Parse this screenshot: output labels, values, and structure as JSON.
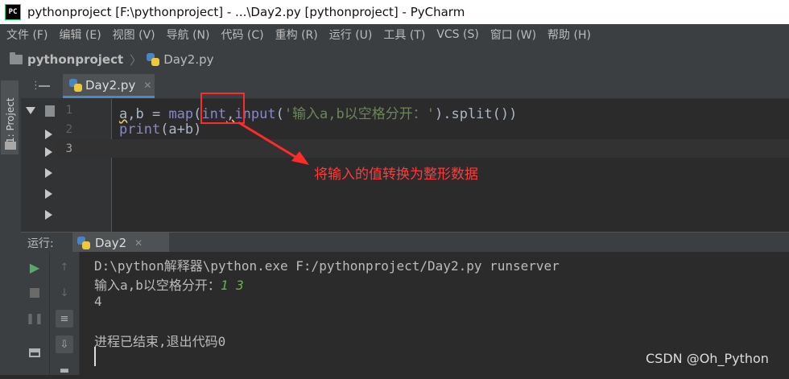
{
  "window": {
    "title": "pythonproject [F:\\pythonproject] - ...\\Day2.py [pythonproject] - PyCharm",
    "icon_text": "PC"
  },
  "menu": [
    "文件 (F)",
    "编辑 (E)",
    "视图 (V)",
    "导航 (N)",
    "代码 (C)",
    "重构 (R)",
    "运行 (U)",
    "工具 (T)",
    "VCS (S)",
    "窗口 (W)",
    "帮助 (H)"
  ],
  "breadcrumb": {
    "project": "pythonproject",
    "file": "Day2.py"
  },
  "side_panel": {
    "project_tab": "1: Project"
  },
  "editor": {
    "tab": {
      "label": "Day2.py",
      "icon": "python-file-icon"
    },
    "line_numbers": [
      "1",
      "2",
      "3"
    ],
    "code": {
      "l1_a": "a",
      "l1_b": ",b = ",
      "l1_map": "map",
      "l1_open": "(",
      "l1_int": "int",
      "l1_comma": ",",
      "l1_input": "input",
      "l1_paren": "(",
      "l1_str": "'输入a,b以空格分开：'",
      "l1_rest": ").split())",
      "l2_print": "print",
      "l2_rest": "(a+b)"
    }
  },
  "annotation": {
    "text": "将输入的值转换为整形数据",
    "color": "#ff3b3b"
  },
  "run": {
    "label": "运行:",
    "tab": "Day2",
    "lines": {
      "cmd": "D:\\python解释器\\python.exe F:/pythonproject/Day2.py runserver",
      "prompt": "输入a,b以空格分开：",
      "input": "1 3",
      "result": "4",
      "exit": "进程已结束,退出代码0"
    }
  },
  "watermark": "CSDN @Oh_Python",
  "colors": {
    "accent": "#4a88c7",
    "annotation_box": "#ff2a2a",
    "run_green": "#62b543"
  }
}
